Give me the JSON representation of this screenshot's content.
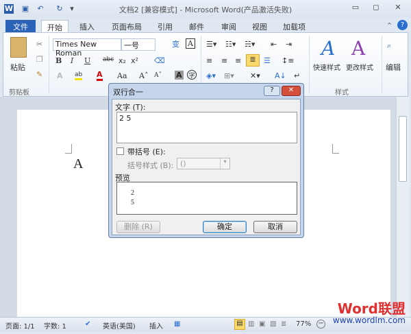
{
  "window": {
    "title": "文档2 [兼容模式] - Microsoft Word(产品激活失败)"
  },
  "tabs": [
    "文件",
    "开始",
    "插入",
    "页面布局",
    "引用",
    "邮件",
    "审阅",
    "视图",
    "加载项"
  ],
  "ribbon": {
    "clipboard": {
      "paste": "粘贴",
      "label": "剪贴板"
    },
    "font": {
      "name": "Times New Roman",
      "size": "一号"
    },
    "styles": {
      "quick": "快速样式",
      "change": "更改样式",
      "label": "样式"
    },
    "editing": {
      "label": "编辑"
    }
  },
  "document": {
    "text": "A"
  },
  "dialog": {
    "title": "双行合一",
    "text_label": "文字 (T):",
    "text_value": "2 5",
    "bracket_checkbox": "带括号 (E):",
    "bracket_style_label": "括号样式 (B):",
    "bracket_style_value": "()",
    "preview_label": "预览",
    "preview_line1": "2",
    "preview_line2": "5",
    "delete_button": "删除 (R)",
    "ok_button": "确定",
    "cancel_button": "取消"
  },
  "status": {
    "page": "页面: 1/1",
    "words": "字数: 1",
    "language": "英语(美国)",
    "mode": "插入",
    "zoom": "77%"
  },
  "watermark": {
    "logo": "Word联盟",
    "url": "www.wordlm.com"
  }
}
